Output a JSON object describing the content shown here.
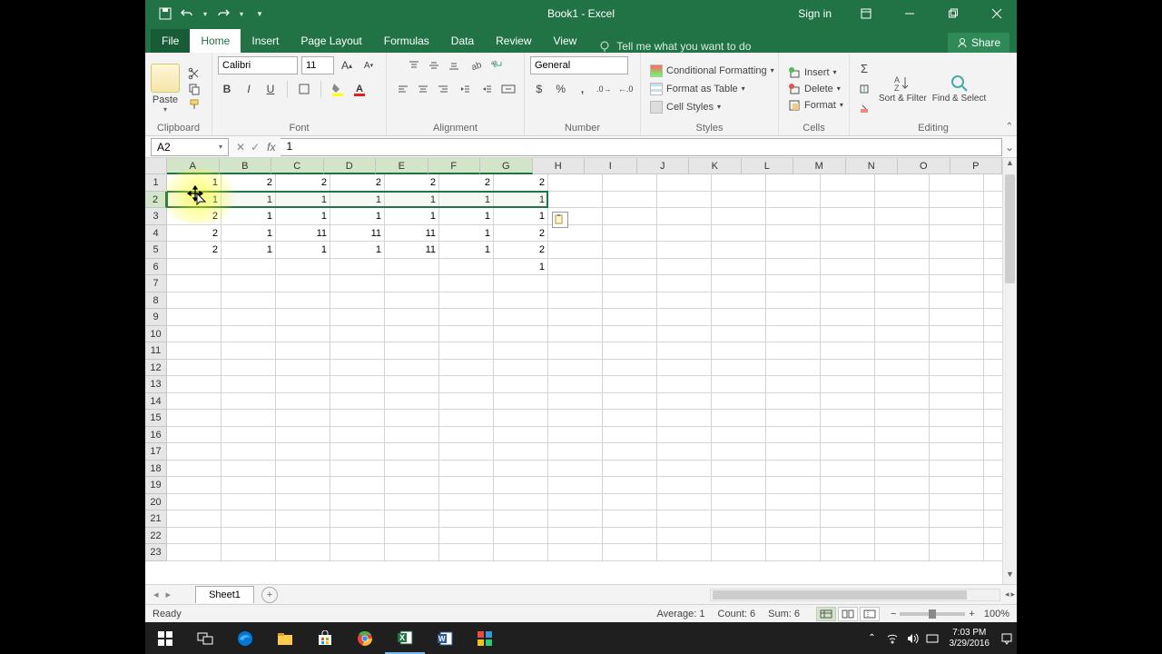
{
  "title": "Book1 - Excel",
  "signin": "Sign in",
  "tabs": {
    "file": "File",
    "home": "Home",
    "insert": "Insert",
    "pagelayout": "Page Layout",
    "formulas": "Formulas",
    "data": "Data",
    "review": "Review",
    "view": "View",
    "tellme": "Tell me what you want to do",
    "share": "Share"
  },
  "ribbon": {
    "clipboard": {
      "paste": "Paste",
      "label": "Clipboard"
    },
    "font": {
      "name": "Calibri",
      "size": "11",
      "label": "Font"
    },
    "alignment": {
      "label": "Alignment"
    },
    "number": {
      "format": "General",
      "label": "Number"
    },
    "styles": {
      "cond": "Conditional Formatting",
      "table": "Format as Table",
      "cell": "Cell Styles",
      "label": "Styles"
    },
    "cells": {
      "insert": "Insert",
      "delete": "Delete",
      "format": "Format",
      "label": "Cells"
    },
    "editing": {
      "sort": "Sort & Filter",
      "find": "Find & Select",
      "label": "Editing"
    }
  },
  "namebox": "A2",
  "formula": "1",
  "columns": [
    "A",
    "B",
    "C",
    "D",
    "E",
    "F",
    "G",
    "H",
    "I",
    "J",
    "K",
    "L",
    "M",
    "N",
    "O",
    "P"
  ],
  "rows": 23,
  "selected_columns": [
    "A",
    "B",
    "C",
    "D",
    "E",
    "F",
    "G"
  ],
  "selected_row": 2,
  "selection": {
    "row": 2,
    "col_start": 0,
    "col_end": 6
  },
  "cells": {
    "1": {
      "A": "1",
      "B": "2",
      "C": "2",
      "D": "2",
      "E": "2",
      "F": "2",
      "G": "2"
    },
    "2": {
      "A": "1",
      "B": "1",
      "C": "1",
      "D": "1",
      "E": "1",
      "F": "1",
      "G": "1"
    },
    "3": {
      "A": "2",
      "B": "1",
      "C": "1",
      "D": "1",
      "E": "1",
      "F": "1",
      "G": "1"
    },
    "4": {
      "A": "2",
      "B": "1",
      "C": "11",
      "D": "11",
      "E": "11",
      "F": "1",
      "G": "2"
    },
    "5": {
      "A": "2",
      "B": "1",
      "C": "1",
      "D": "1",
      "E": "11",
      "F": "1",
      "G": "2"
    },
    "6": {
      "G": "1"
    }
  },
  "sheet_tab": "Sheet1",
  "status": {
    "ready": "Ready",
    "avg": "Average: 1",
    "count": "Count: 6",
    "sum": "Sum: 6",
    "zoom": "100%"
  },
  "clock": {
    "time": "7:03 PM",
    "date": "3/29/2016"
  }
}
